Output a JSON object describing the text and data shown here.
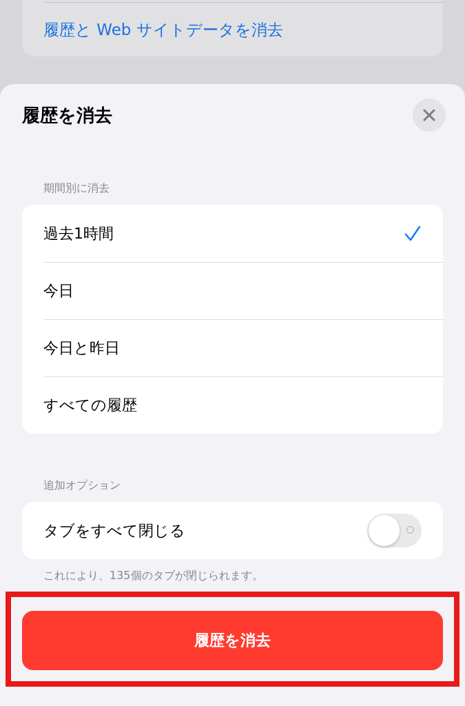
{
  "background_card": {
    "link": "履歴と Web サイトデータを消去"
  },
  "sheet": {
    "title": "履歴を消去"
  },
  "period": {
    "header": "期間別に消去",
    "options": [
      {
        "label": "過去1時間",
        "selected": true
      },
      {
        "label": "今日",
        "selected": false
      },
      {
        "label": "今日と昨日",
        "selected": false
      },
      {
        "label": "すべての履歴",
        "selected": false
      }
    ]
  },
  "additional": {
    "header": "追加オプション",
    "options": [
      {
        "label": "タブをすべて閉じる",
        "on": false
      }
    ],
    "footer": "これにより、135個のタブが閉じられます。"
  },
  "clear_button": {
    "label": "履歴を消去",
    "highlighted": true
  }
}
